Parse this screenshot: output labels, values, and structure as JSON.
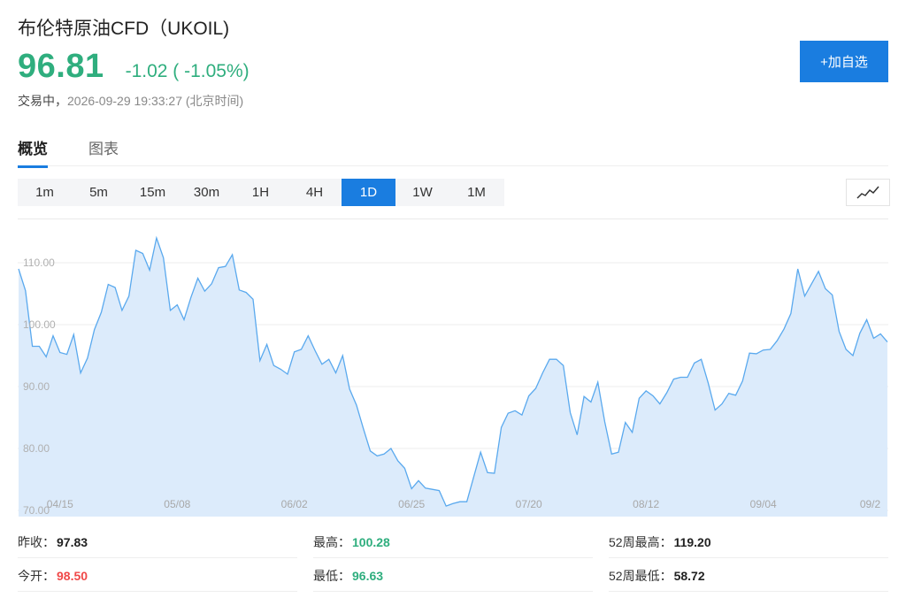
{
  "header": {
    "title": "布伦特原油CFD（UKOIL)",
    "price": "96.81",
    "change": "-1.02 ( -1.05%)",
    "status_label": "交易中，",
    "timestamp": "2026-09-29 19:33:27 (北京时间)",
    "add_button": "+加自选"
  },
  "tabs": [
    {
      "label": "概览",
      "active": true
    },
    {
      "label": "图表",
      "active": false
    }
  ],
  "timeframes": [
    "1m",
    "5m",
    "15m",
    "30m",
    "1H",
    "4H",
    "1D",
    "1W",
    "1M"
  ],
  "active_timeframe": "1D",
  "icons": {
    "chart_type": "line-chart-icon"
  },
  "colors": {
    "up": "#f04848",
    "down": "#2fae7e",
    "accent": "#1a7de0",
    "line": "#5aa9ee",
    "fill": "#dcebfb"
  },
  "stats": {
    "prev_close_label": "昨收：",
    "prev_close": "97.83",
    "high_label": "最高：",
    "high": "100.28",
    "w52_high_label": "52周最高：",
    "w52_high": "119.20",
    "open_label": "今开：",
    "open": "98.50",
    "low_label": "最低：",
    "low": "96.63",
    "w52_low_label": "52周最低：",
    "w52_low": "58.72"
  },
  "chart_data": {
    "type": "area",
    "ylim": [
      69,
      117
    ],
    "yticks": [
      "70.00",
      "80.00",
      "90.00",
      "100.00",
      "110.00"
    ],
    "xticks": [
      {
        "label": "04/15",
        "index": 6
      },
      {
        "label": "05/08",
        "index": 23
      },
      {
        "label": "06/02",
        "index": 40
      },
      {
        "label": "06/25",
        "index": 57
      },
      {
        "label": "07/20",
        "index": 74
      },
      {
        "label": "08/12",
        "index": 91
      },
      {
        "label": "09/04",
        "index": 108
      },
      {
        "label": "09/2",
        "index": 125
      }
    ],
    "values": [
      109,
      105.5,
      96.5,
      96.5,
      94.8,
      98.2,
      95.5,
      95.2,
      98.4,
      92.2,
      94.6,
      99.2,
      102,
      106.5,
      106,
      102.3,
      104.6,
      112,
      111.5,
      108.8,
      114,
      110.8,
      102.3,
      103.2,
      100.8,
      104.4,
      107.5,
      105.4,
      106.6,
      109.2,
      109.4,
      111.3,
      105.6,
      105.2,
      104.1,
      94.2,
      96.8,
      93.4,
      92.8,
      92,
      95.6,
      96,
      98.2,
      95.8,
      93.6,
      94.4,
      92.2,
      95,
      89.6,
      87,
      83.2,
      79.6,
      78.8,
      79.1,
      80,
      78,
      76.8,
      73.5,
      74.8,
      73.6,
      73.4,
      73.2,
      70.7,
      71.1,
      71.4,
      71.4,
      75.4,
      79.4,
      76.1,
      76,
      83.4,
      85.7,
      86.1,
      85.4,
      88.5,
      89.7,
      92.2,
      94.4,
      94.4,
      93.4,
      85.8,
      82.2,
      88.4,
      87.5,
      90.7,
      84.3,
      79.1,
      79.4,
      84.2,
      82.6,
      88.1,
      89.3,
      88.5,
      87.2,
      89,
      91.2,
      91.5,
      91.5,
      93.8,
      94.4,
      90.6,
      86.2,
      87.2,
      88.9,
      88.6,
      90.9,
      95.4,
      95.3,
      95.9,
      96,
      97.4,
      99.3,
      101.8,
      109,
      104.6,
      106.6,
      108.6,
      105.8,
      104.8,
      98.9,
      96,
      95,
      98.6,
      100.8,
      97.8,
      98.5,
      97.2
    ]
  }
}
